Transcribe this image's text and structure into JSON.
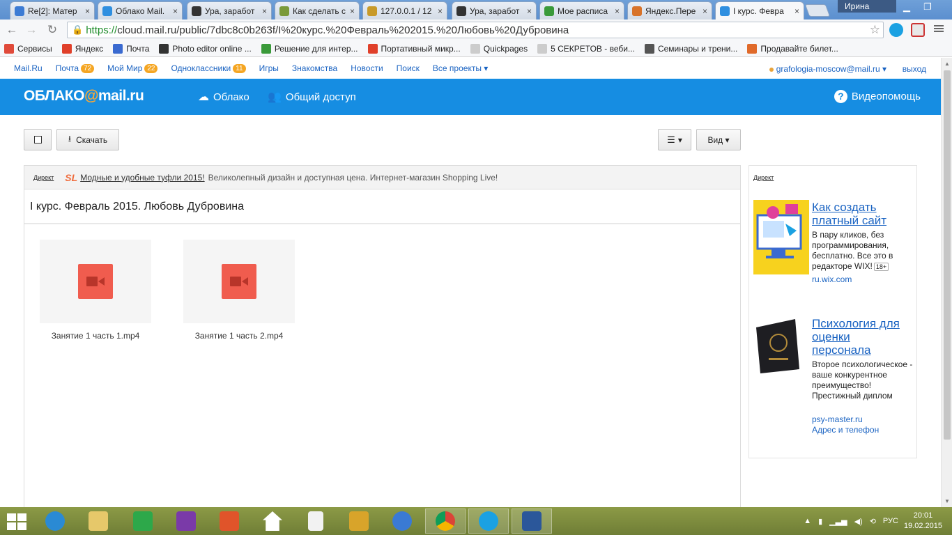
{
  "browser": {
    "tabs": [
      {
        "label": "Re[2]: Матер",
        "color": "#3c7bd4"
      },
      {
        "label": "Облако Mail.",
        "color": "#2f8fe0"
      },
      {
        "label": "Ура, заработ",
        "color": "#333333"
      },
      {
        "label": "Как сделать с",
        "color": "#7a9a3a"
      },
      {
        "label": "127.0.0.1 / 12",
        "color": "#c89a2a"
      },
      {
        "label": "Ура, заработ",
        "color": "#333333"
      },
      {
        "label": "Мое расписа",
        "color": "#3a9a3a"
      },
      {
        "label": "Яндекс.Пере",
        "color": "#d8732a"
      },
      {
        "label": "I курс. Февра",
        "color": "#2f8fe0",
        "active": true
      }
    ],
    "close_glyph": "×",
    "user": "Ирина",
    "url_protocol": "https://",
    "url_rest": "cloud.mail.ru/public/7dbc8c0b263f/I%20курс.%20Февраль%202015.%20Любовь%20Дубровина",
    "bookmarks": [
      {
        "label": "Сервисы",
        "color": "#e04a3a"
      },
      {
        "label": "Яндекс",
        "color": "#e0402a"
      },
      {
        "label": "Почта",
        "color": "#3a6ad0"
      },
      {
        "label": "Photo editor online ...",
        "color": "#333333"
      },
      {
        "label": "Решение для интер...",
        "color": "#3a9a3a"
      },
      {
        "label": "Портативный микр...",
        "color": "#e0402a"
      },
      {
        "label": "Quickpages",
        "color": "#cccccc"
      },
      {
        "label": "5 СЕКРЕТОВ - веби...",
        "color": "#cccccc"
      },
      {
        "label": "Семинары и трени...",
        "color": "#555555"
      },
      {
        "label": "Продавайте билет...",
        "color": "#e06a2a"
      }
    ]
  },
  "portal": {
    "links": [
      {
        "label": "Mail.Ru"
      },
      {
        "label": "Почта",
        "badge": "72"
      },
      {
        "label": "Мой Мир",
        "badge": "22"
      },
      {
        "label": "Одноклассники",
        "badge": "11"
      },
      {
        "label": "Игры"
      },
      {
        "label": "Знакомства"
      },
      {
        "label": "Новости"
      },
      {
        "label": "Поиск"
      },
      {
        "label": "Все проекты ▾"
      }
    ],
    "account": "grafologia-moscow@mail.ru ▾",
    "logout": "выход"
  },
  "header": {
    "logo_left": "ОБЛАКО",
    "logo_at": "@",
    "logo_right": "mail.ru",
    "cloud": "Облако",
    "shared": "Общий доступ",
    "help": "Видеопомощь"
  },
  "toolbar": {
    "download": "Скачать",
    "sort": "▾",
    "view": "Вид ▾"
  },
  "ad": {
    "direct": "Директ",
    "logo": "SL",
    "link": "Модные и удобные туфли 2015!",
    "text": "Великолепный дизайн и доступная цена. Интернет-магазин Shopping Live!"
  },
  "folder": {
    "title": "I курс. Февраль 2015. Любовь Дубровина",
    "files": [
      {
        "name": "Занятие 1 часть 1.mp4"
      },
      {
        "name": "Занятие 1 часть 2.mp4"
      }
    ]
  },
  "side_ads": {
    "direct": "Директ",
    "ad1": {
      "title": "Как создать платный сайт",
      "text": "В пару кликов, без программирования, бесплатно. Все это в редакторе WIX!",
      "age": "18+",
      "domain": "ru.wix.com"
    },
    "ad2": {
      "title": "Психология для оценки персонала",
      "text": "Второе психологическое - ваше конкурентное преимущество! Престижный диплом",
      "domain": "psy-master.ru",
      "contacts": "Адрес и телефон"
    }
  },
  "taskbar": {
    "lang": "РУС",
    "time": "20:01",
    "date": "19.02.2015"
  }
}
